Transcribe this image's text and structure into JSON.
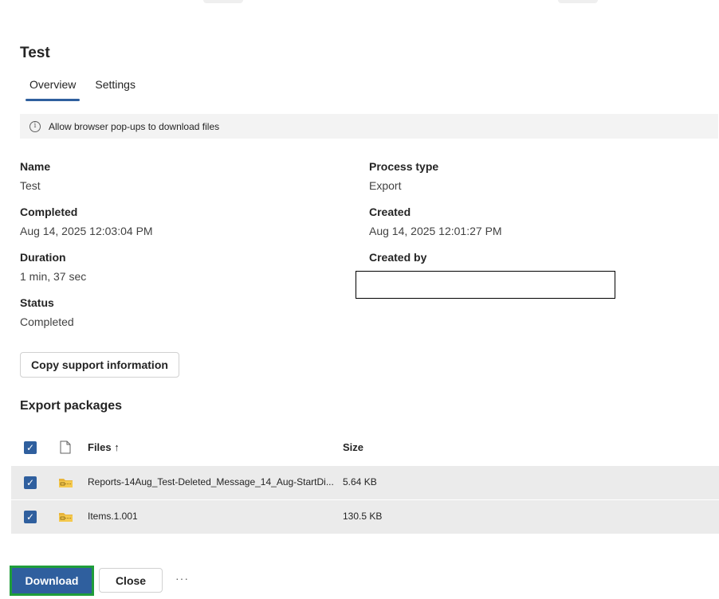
{
  "header": {
    "title": "Test"
  },
  "tabs": [
    {
      "label": "Overview",
      "active": true
    },
    {
      "label": "Settings",
      "active": false
    }
  ],
  "notice": {
    "text": "Allow browser pop-ups to download files",
    "icon": "info-icon"
  },
  "details": {
    "name_label": "Name",
    "name_value": "Test",
    "completed_label": "Completed",
    "completed_value": "Aug 14, 2025 12:03:04 PM",
    "duration_label": "Duration",
    "duration_value": "1 min, 37 sec",
    "status_label": "Status",
    "status_value": "Completed",
    "process_type_label": "Process type",
    "process_type_value": "Export",
    "created_label": "Created",
    "created_value": "Aug 14, 2025 12:01:27 PM",
    "created_by_label": "Created by"
  },
  "copy_support_label": "Copy support information",
  "export_packages": {
    "title": "Export packages",
    "columns": {
      "files": "Files ↑",
      "size": "Size"
    },
    "rows": [
      {
        "file": "Reports-14Aug_Test-Deleted_Message_14_Aug-StartDi...",
        "size": "5.64 KB",
        "checked": true
      },
      {
        "file": "Items.1.001",
        "size": "130.5 KB",
        "checked": true
      }
    ]
  },
  "footer": {
    "download_label": "Download",
    "close_label": "Close",
    "more_label": "···"
  },
  "colors": {
    "accent": "#2f5f9e",
    "highlight_border": "#1f9d3a",
    "row_bg": "#ebebeb",
    "notice_bg": "#f3f3f3"
  }
}
